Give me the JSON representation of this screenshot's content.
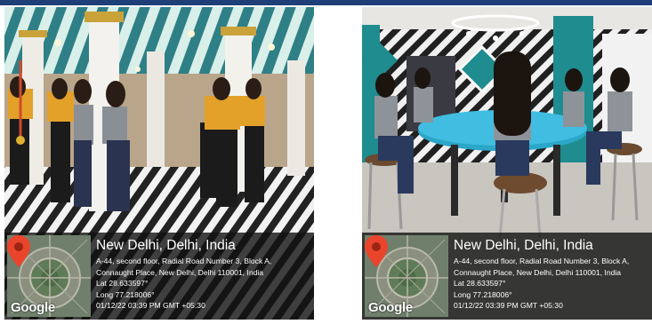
{
  "photos": [
    {
      "title": "New Delhi, Delhi, India",
      "address_line1": "A-44, second floor, Radial Road Number 3, Block A,",
      "address_line2": "Connaught Place, New Delhi, Delhi 110001, India",
      "latitude": "Lat 28.633597°",
      "longitude": "Long 77.218006°",
      "timestamp": "01/12/22 03:39 PM GMT +05:30",
      "map_brand": "Google",
      "map_icon": "location-pin-icon"
    },
    {
      "title": "New Delhi, Delhi, India",
      "address_line1": "A-44, second floor, Radial Road Number 3, Block A,",
      "address_line2": "Connaught Place, New Delhi, Delhi 110001, India",
      "latitude": "Lat 28.633597°",
      "longitude": "Long 77.218006°",
      "timestamp": "01/12/22 03:39 PM GMT +05:30",
      "map_brand": "Google",
      "map_icon": "location-pin-icon"
    }
  ],
  "colors": {
    "top_bar": "#1e3f78",
    "overlay": "#121212",
    "pin": "#e8452c"
  }
}
